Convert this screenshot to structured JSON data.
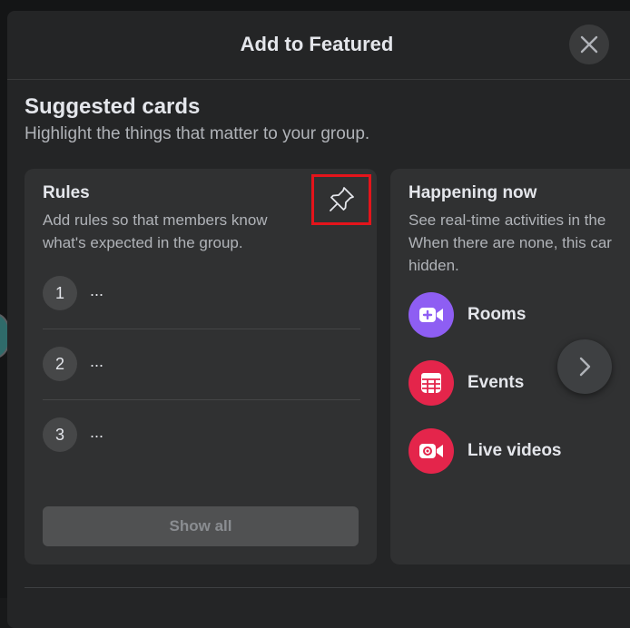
{
  "modal": {
    "title": "Add to Featured"
  },
  "section": {
    "title": "Suggested cards",
    "subtitle": "Highlight the things that matter to your group."
  },
  "rules_card": {
    "title": "Rules",
    "description": "Add rules so that members know what's expected in the group.",
    "items": [
      {
        "number": "1",
        "text": "..."
      },
      {
        "number": "2",
        "text": "..."
      },
      {
        "number": "3",
        "text": "..."
      }
    ],
    "show_all_label": "Show all"
  },
  "happening_card": {
    "title": "Happening now",
    "description_lines": [
      "See real-time activities in the",
      "When there are none, this car",
      "hidden."
    ],
    "activities": [
      {
        "label": "Rooms",
        "icon": "video-plus-icon",
        "color": "#8e5ef3"
      },
      {
        "label": "Events",
        "icon": "calendar-icon",
        "color": "#e4254b"
      },
      {
        "label": "Live videos",
        "icon": "live-video-icon",
        "color": "#e4254b"
      }
    ]
  },
  "colors": {
    "modal_bg": "#242526",
    "card_bg": "#303132",
    "highlight": "#e4141b"
  }
}
